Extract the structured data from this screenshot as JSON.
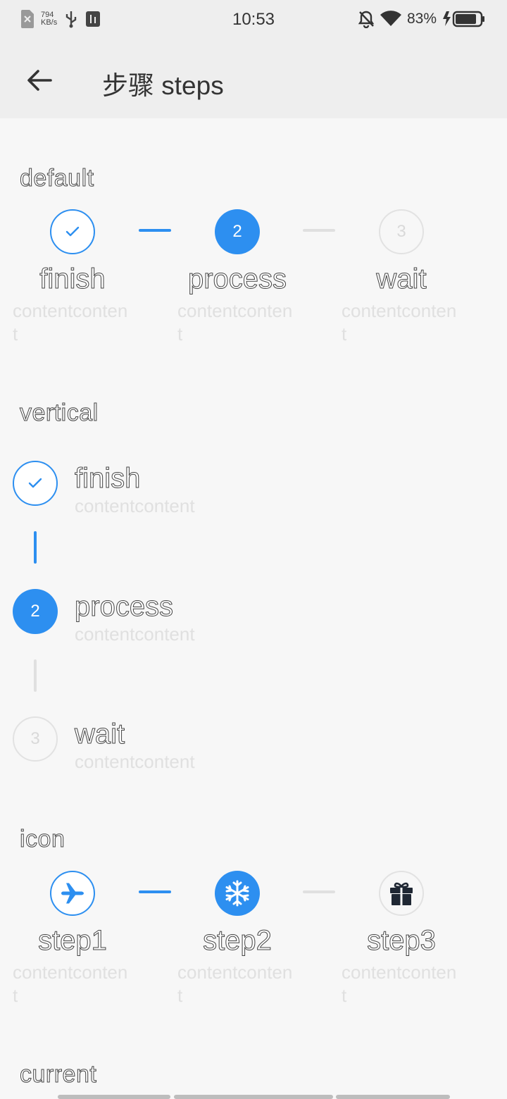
{
  "status_bar": {
    "net_speed_value": "794",
    "net_speed_unit": "KB/s",
    "time": "10:53",
    "battery": "83%"
  },
  "header": {
    "title": "步骤 steps",
    "back_icon": "arrow-left-icon"
  },
  "sections": {
    "default": {
      "title": "default",
      "steps": [
        {
          "state": "finish",
          "marker": "check-icon",
          "title": "finish",
          "content": "contentcontent"
        },
        {
          "state": "process",
          "marker": "2",
          "title": "process",
          "content": "contentcontent"
        },
        {
          "state": "wait",
          "marker": "3",
          "title": "wait",
          "content": "contentcontent"
        }
      ]
    },
    "vertical": {
      "title": "vertical",
      "steps": [
        {
          "state": "finish",
          "marker": "check-icon",
          "title": "finish",
          "content": "contentcontent"
        },
        {
          "state": "process",
          "marker": "2",
          "title": "process",
          "content": "contentcontent"
        },
        {
          "state": "wait",
          "marker": "3",
          "title": "wait",
          "content": "contentcontent"
        }
      ]
    },
    "icon": {
      "title": "icon",
      "steps": [
        {
          "state": "finish",
          "icon": "airplane-icon",
          "title": "step1",
          "content": "contentcontent"
        },
        {
          "state": "process",
          "icon": "snowflake-icon",
          "title": "step2",
          "content": "contentcontent"
        },
        {
          "state": "wait",
          "icon": "gift-icon",
          "title": "step3",
          "content": "contentcontent"
        }
      ]
    },
    "current": {
      "title": "current"
    }
  },
  "colors": {
    "accent": "#2d8ff0",
    "inactive_line": "#e0e0e0",
    "background": "#f7f7f7"
  }
}
